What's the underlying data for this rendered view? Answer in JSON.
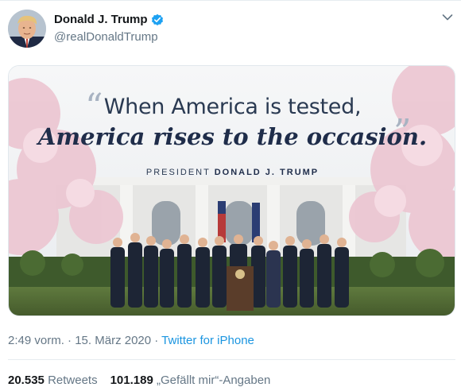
{
  "author": {
    "display_name": "Donald J. Trump",
    "handle": "@realDonaldTrump",
    "verified": true
  },
  "media": {
    "quote_line1": "When America is tested,",
    "quote_line2": "America rises to the occasion.",
    "attribution_prefix": "PRESIDENT",
    "attribution_name": "DONALD J. TRUMP"
  },
  "meta": {
    "time": "2:49 vorm.",
    "separator": " · ",
    "date": "15. März 2020",
    "source": "Twitter for iPhone"
  },
  "stats": {
    "retweets_count": "20.535",
    "retweets_label": "Retweets",
    "likes_count": "101.189",
    "likes_label": "„Gefällt mir“-Angaben"
  },
  "colors": {
    "link": "#1b95e0",
    "verified": "#1da1f2",
    "secondary_text": "#657786"
  },
  "icons": {
    "verified": "verified-badge-icon",
    "menu": "chevron-down-icon"
  }
}
